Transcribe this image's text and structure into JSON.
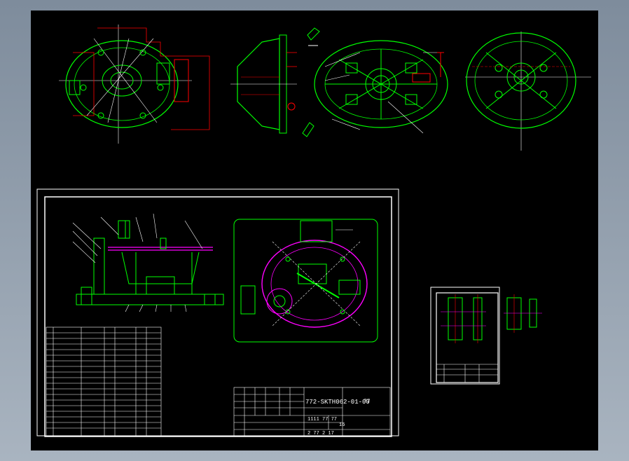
{
  "title_block": {
    "drawing_no": "772-SKTH062-01-00",
    "sheet_label": "77",
    "scale_row": "1111  77  77",
    "qty": "16",
    "footer": "2 77  2 17"
  },
  "colors": {
    "background": "#000000",
    "frame": "#ffffff",
    "part": "#00ff00",
    "dimension": "#ff0000",
    "fixture": "#ff00ff",
    "centerline": "#ffffff",
    "frame_outer_bg": "#8a97a6"
  }
}
